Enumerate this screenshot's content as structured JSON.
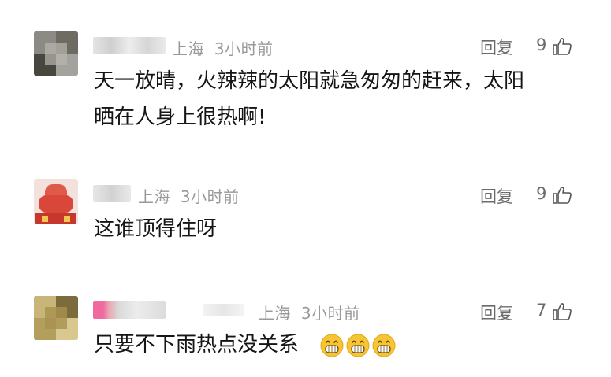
{
  "comments": [
    {
      "location": "上海",
      "time": "3小时前",
      "reply_label": "回复",
      "likes": "9",
      "text_lines": [
        "天一放晴，火辣辣的太阳就急匆匆的赶来，太阳",
        "晒在人身上很热啊!"
      ]
    },
    {
      "location": "上海",
      "time": "3小时前",
      "reply_label": "回复",
      "likes": "9",
      "text_lines": [
        "这谁顶得住呀"
      ]
    },
    {
      "location": "上海",
      "time": "3小时前",
      "reply_label": "回复",
      "likes": "7",
      "text_lines": [
        "只要不下雨热点没关系"
      ],
      "emojis": [
        "grinning-face-icon",
        "grinning-face-icon",
        "grinning-face-icon"
      ]
    }
  ],
  "colors": {
    "meta_text": "#9a9a9a",
    "action_text": "#6b6b6b",
    "body_text": "#151515",
    "emoji_face": "#f7c531"
  }
}
